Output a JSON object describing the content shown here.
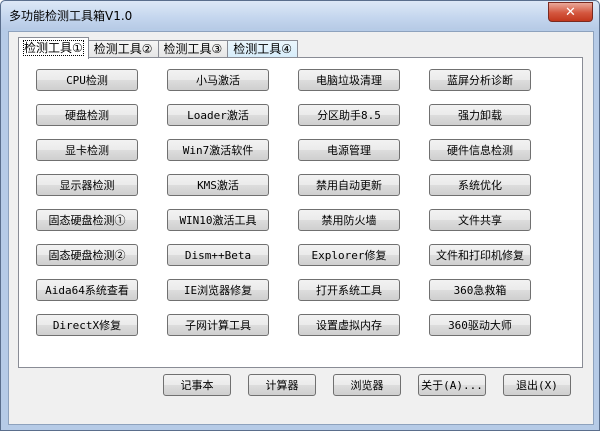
{
  "window": {
    "title": "多功能检测工具箱V1.0",
    "close_label": "✕"
  },
  "tabs": [
    {
      "label": "检测工具①",
      "active": true
    },
    {
      "label": "检测工具②"
    },
    {
      "label": "检测工具③"
    },
    {
      "label": "检测工具④",
      "hover": true
    }
  ],
  "grid_buttons": [
    "CPU检测",
    "小马激活",
    "电脑垃圾清理",
    "蓝屏分析诊断",
    "硬盘检测",
    "Loader激活",
    "分区助手8.5",
    "强力卸载",
    "显卡检测",
    "Win7激活软件",
    "电源管理",
    "硬件信息检测",
    "显示器检测",
    "KMS激活",
    "禁用自动更新",
    "系统优化",
    "固态硬盘检测①",
    "WIN10激活工具",
    "禁用防火墙",
    "文件共享",
    "固态硬盘检测②",
    "Dism++Beta",
    "Explorer修复",
    "文件和打印机修复",
    "Aida64系统查看",
    "IE浏览器修复",
    "打开系统工具",
    "360急救箱",
    "DirectX修复",
    "子网计算工具",
    "设置虚拟内存",
    "360驱动大师"
  ],
  "bottom_buttons": [
    "记事本",
    "计算器",
    "浏览器",
    "关于(A)...",
    "退出(X)"
  ]
}
